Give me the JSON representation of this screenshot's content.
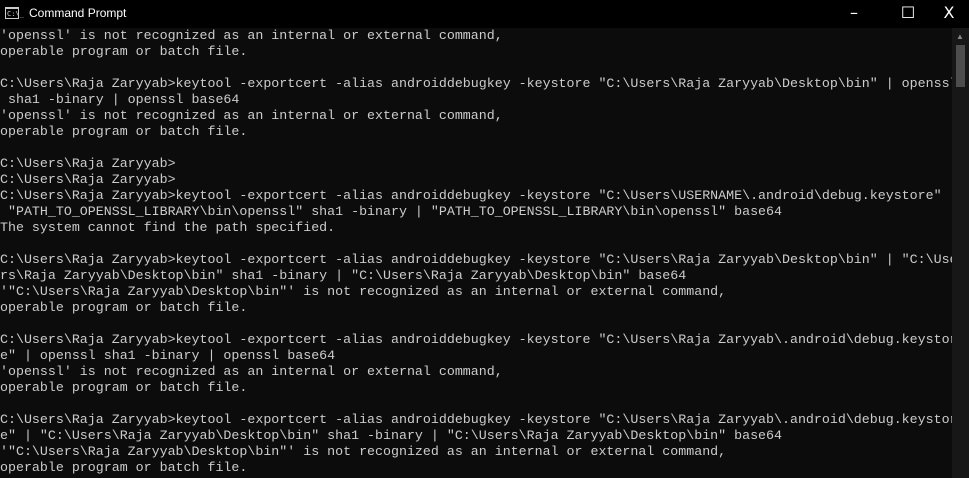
{
  "window": {
    "title": "Command Prompt",
    "app_icon": "C:\\_",
    "minimize": "–",
    "maximize": "☐",
    "close": "X"
  },
  "console": {
    "lines": [
      "'openssl' is not recognized as an internal or external command,",
      "operable program or batch file.",
      "",
      "C:\\Users\\Raja Zaryyab>keytool -exportcert -alias androiddebugkey -keystore \"C:\\Users\\Raja Zaryyab\\Desktop\\bin\" | openssl",
      " sha1 -binary | openssl base64",
      "'openssl' is not recognized as an internal or external command,",
      "operable program or batch file.",
      "",
      "C:\\Users\\Raja Zaryyab>",
      "C:\\Users\\Raja Zaryyab>",
      "C:\\Users\\Raja Zaryyab>keytool -exportcert -alias androiddebugkey -keystore \"C:\\Users\\USERNAME\\.android\\debug.keystore\" |",
      " \"PATH_TO_OPENSSL_LIBRARY\\bin\\openssl\" sha1 -binary | \"PATH_TO_OPENSSL_LIBRARY\\bin\\openssl\" base64",
      "The system cannot find the path specified.",
      "",
      "C:\\Users\\Raja Zaryyab>keytool -exportcert -alias androiddebugkey -keystore \"C:\\Users\\Raja Zaryyab\\Desktop\\bin\" | \"C:\\Use",
      "rs\\Raja Zaryyab\\Desktop\\bin\" sha1 -binary | \"C:\\Users\\Raja Zaryyab\\Desktop\\bin\" base64",
      "'\"C:\\Users\\Raja Zaryyab\\Desktop\\bin\"' is not recognized as an internal or external command,",
      "operable program or batch file.",
      "",
      "C:\\Users\\Raja Zaryyab>keytool -exportcert -alias androiddebugkey -keystore \"C:\\Users\\Raja Zaryyab\\.android\\debug.keystor",
      "e\" | openssl sha1 -binary | openssl base64",
      "'openssl' is not recognized as an internal or external command,",
      "operable program or batch file.",
      "",
      "C:\\Users\\Raja Zaryyab>keytool -exportcert -alias androiddebugkey -keystore \"C:\\Users\\Raja Zaryyab\\.android\\debug.keystor",
      "e\" | \"C:\\Users\\Raja Zaryyab\\Desktop\\bin\" sha1 -binary | \"C:\\Users\\Raja Zaryyab\\Desktop\\bin\" base64",
      "'\"C:\\Users\\Raja Zaryyab\\Desktop\\bin\"' is not recognized as an internal or external command,",
      "operable program or batch file."
    ]
  },
  "scrollbar": {
    "up_arrow": "▲"
  }
}
